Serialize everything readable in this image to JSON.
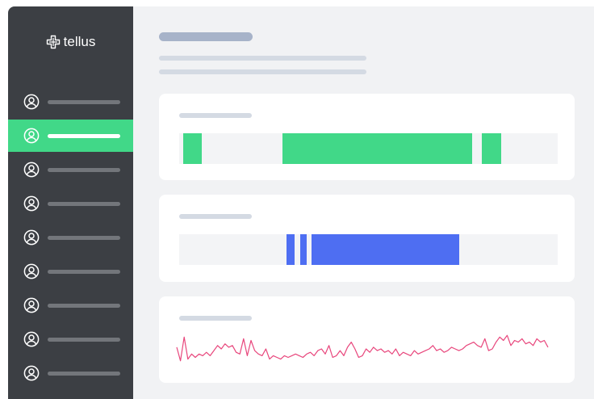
{
  "app": {
    "brand": "tellus",
    "brand_icon": "plus-cross-logo-icon"
  },
  "sidebar": {
    "items": [
      {
        "icon": "user-circle-icon",
        "active": false
      },
      {
        "icon": "user-circle-icon",
        "active": true
      },
      {
        "icon": "user-circle-icon",
        "active": false
      },
      {
        "icon": "user-circle-icon",
        "active": false
      },
      {
        "icon": "user-circle-icon",
        "active": false
      },
      {
        "icon": "user-circle-icon",
        "active": false
      },
      {
        "icon": "user-circle-icon",
        "active": false
      },
      {
        "icon": "user-circle-icon",
        "active": false
      },
      {
        "icon": "user-circle-icon",
        "active": false
      }
    ]
  },
  "colors": {
    "sidebar_bg": "#3c3f44",
    "active_item": "#41d888",
    "green_segments": "#41d888",
    "blue_segments": "#4e6ef2",
    "sparkline": "#e8467c",
    "page_bg": "#f1f2f4"
  },
  "cards": [
    {
      "type": "timeline",
      "color": "#41d888",
      "segments": [
        {
          "start": 0.01,
          "end": 0.06
        },
        {
          "start": 0.272,
          "end": 0.775
        },
        {
          "start": 0.8,
          "end": 0.85
        }
      ]
    },
    {
      "type": "timeline",
      "color": "#4e6ef2",
      "segments": [
        {
          "start": 0.284,
          "end": 0.305
        },
        {
          "start": 0.32,
          "end": 0.336
        },
        {
          "start": 0.35,
          "end": 0.74
        }
      ]
    },
    {
      "type": "sparkline",
      "color": "#e8467c",
      "values": [
        0.55,
        0.15,
        0.85,
        0.2,
        0.35,
        0.25,
        0.35,
        0.3,
        0.4,
        0.3,
        0.45,
        0.6,
        0.5,
        0.65,
        0.55,
        0.6,
        0.4,
        0.35,
        0.8,
        0.3,
        0.75,
        0.45,
        0.35,
        0.3,
        0.5,
        0.2,
        0.3,
        0.25,
        0.2,
        0.3,
        0.25,
        0.3,
        0.35,
        0.3,
        0.25,
        0.35,
        0.4,
        0.3,
        0.45,
        0.5,
        0.35,
        0.6,
        0.25,
        0.3,
        0.45,
        0.3,
        0.55,
        0.7,
        0.5,
        0.25,
        0.3,
        0.5,
        0.4,
        0.55,
        0.45,
        0.5,
        0.4,
        0.45,
        0.35,
        0.5,
        0.3,
        0.4,
        0.35,
        0.3,
        0.45,
        0.35,
        0.4,
        0.45,
        0.5,
        0.6,
        0.45,
        0.5,
        0.4,
        0.45,
        0.55,
        0.5,
        0.45,
        0.5,
        0.6,
        0.65,
        0.7,
        0.6,
        0.55,
        0.8,
        0.45,
        0.5,
        0.7,
        0.85,
        0.75,
        0.9,
        0.6,
        0.75,
        0.7,
        0.8,
        0.65,
        0.7,
        0.6,
        0.8,
        0.7,
        0.75,
        0.55
      ]
    }
  ]
}
